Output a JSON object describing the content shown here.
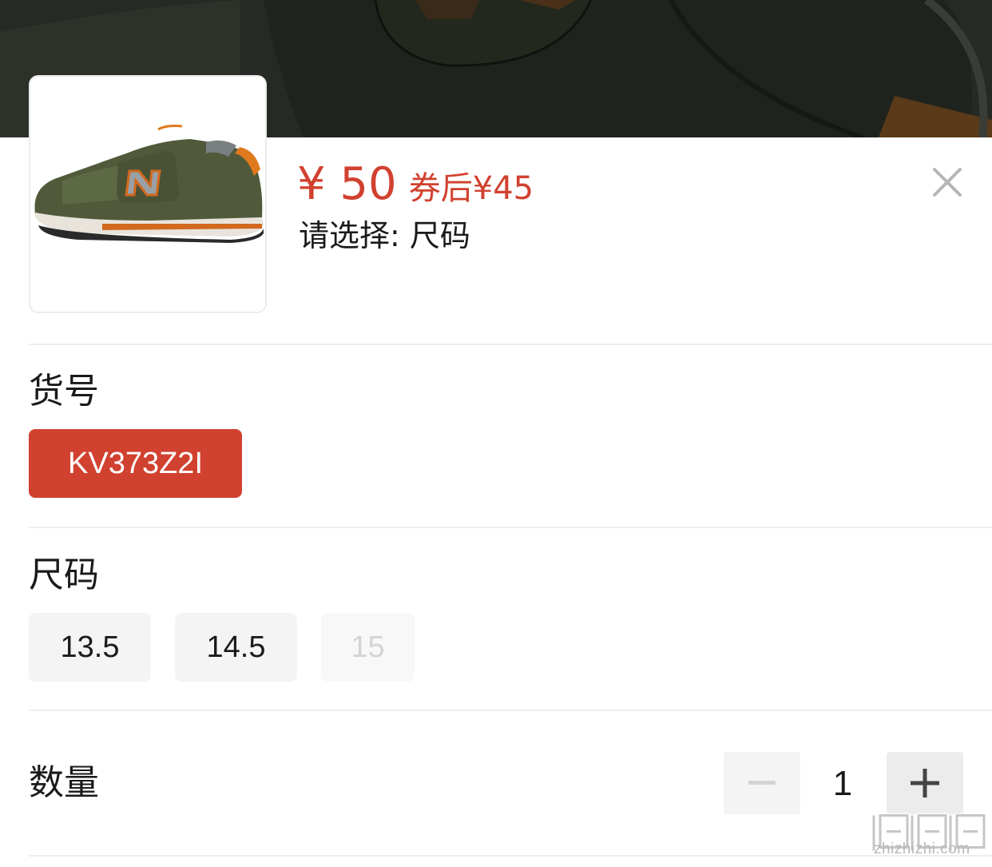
{
  "product": {
    "price": "¥ 50",
    "coupon_price": "券后¥45",
    "select_prompt": "请选择: 尺码"
  },
  "close": {
    "icon": "close-icon"
  },
  "sections": {
    "article": {
      "title": "货号",
      "options": [
        {
          "label": "KV373Z2I",
          "state": "selected"
        }
      ]
    },
    "size": {
      "title": "尺码",
      "options": [
        {
          "label": "13.5",
          "state": "available"
        },
        {
          "label": "14.5",
          "state": "available"
        },
        {
          "label": "15",
          "state": "disabled"
        }
      ]
    },
    "quantity": {
      "title": "数量",
      "value": "1",
      "decrease_icon": "minus-icon",
      "increase_icon": "plus-icon"
    }
  },
  "watermark": {
    "text": "zhizhizhi.com"
  },
  "colors": {
    "accent": "#d1412f",
    "chip_bg": "#f4f4f4",
    "disabled_text": "#d4d4d4",
    "divider": "#ededed",
    "backdrop": "#262a24"
  }
}
